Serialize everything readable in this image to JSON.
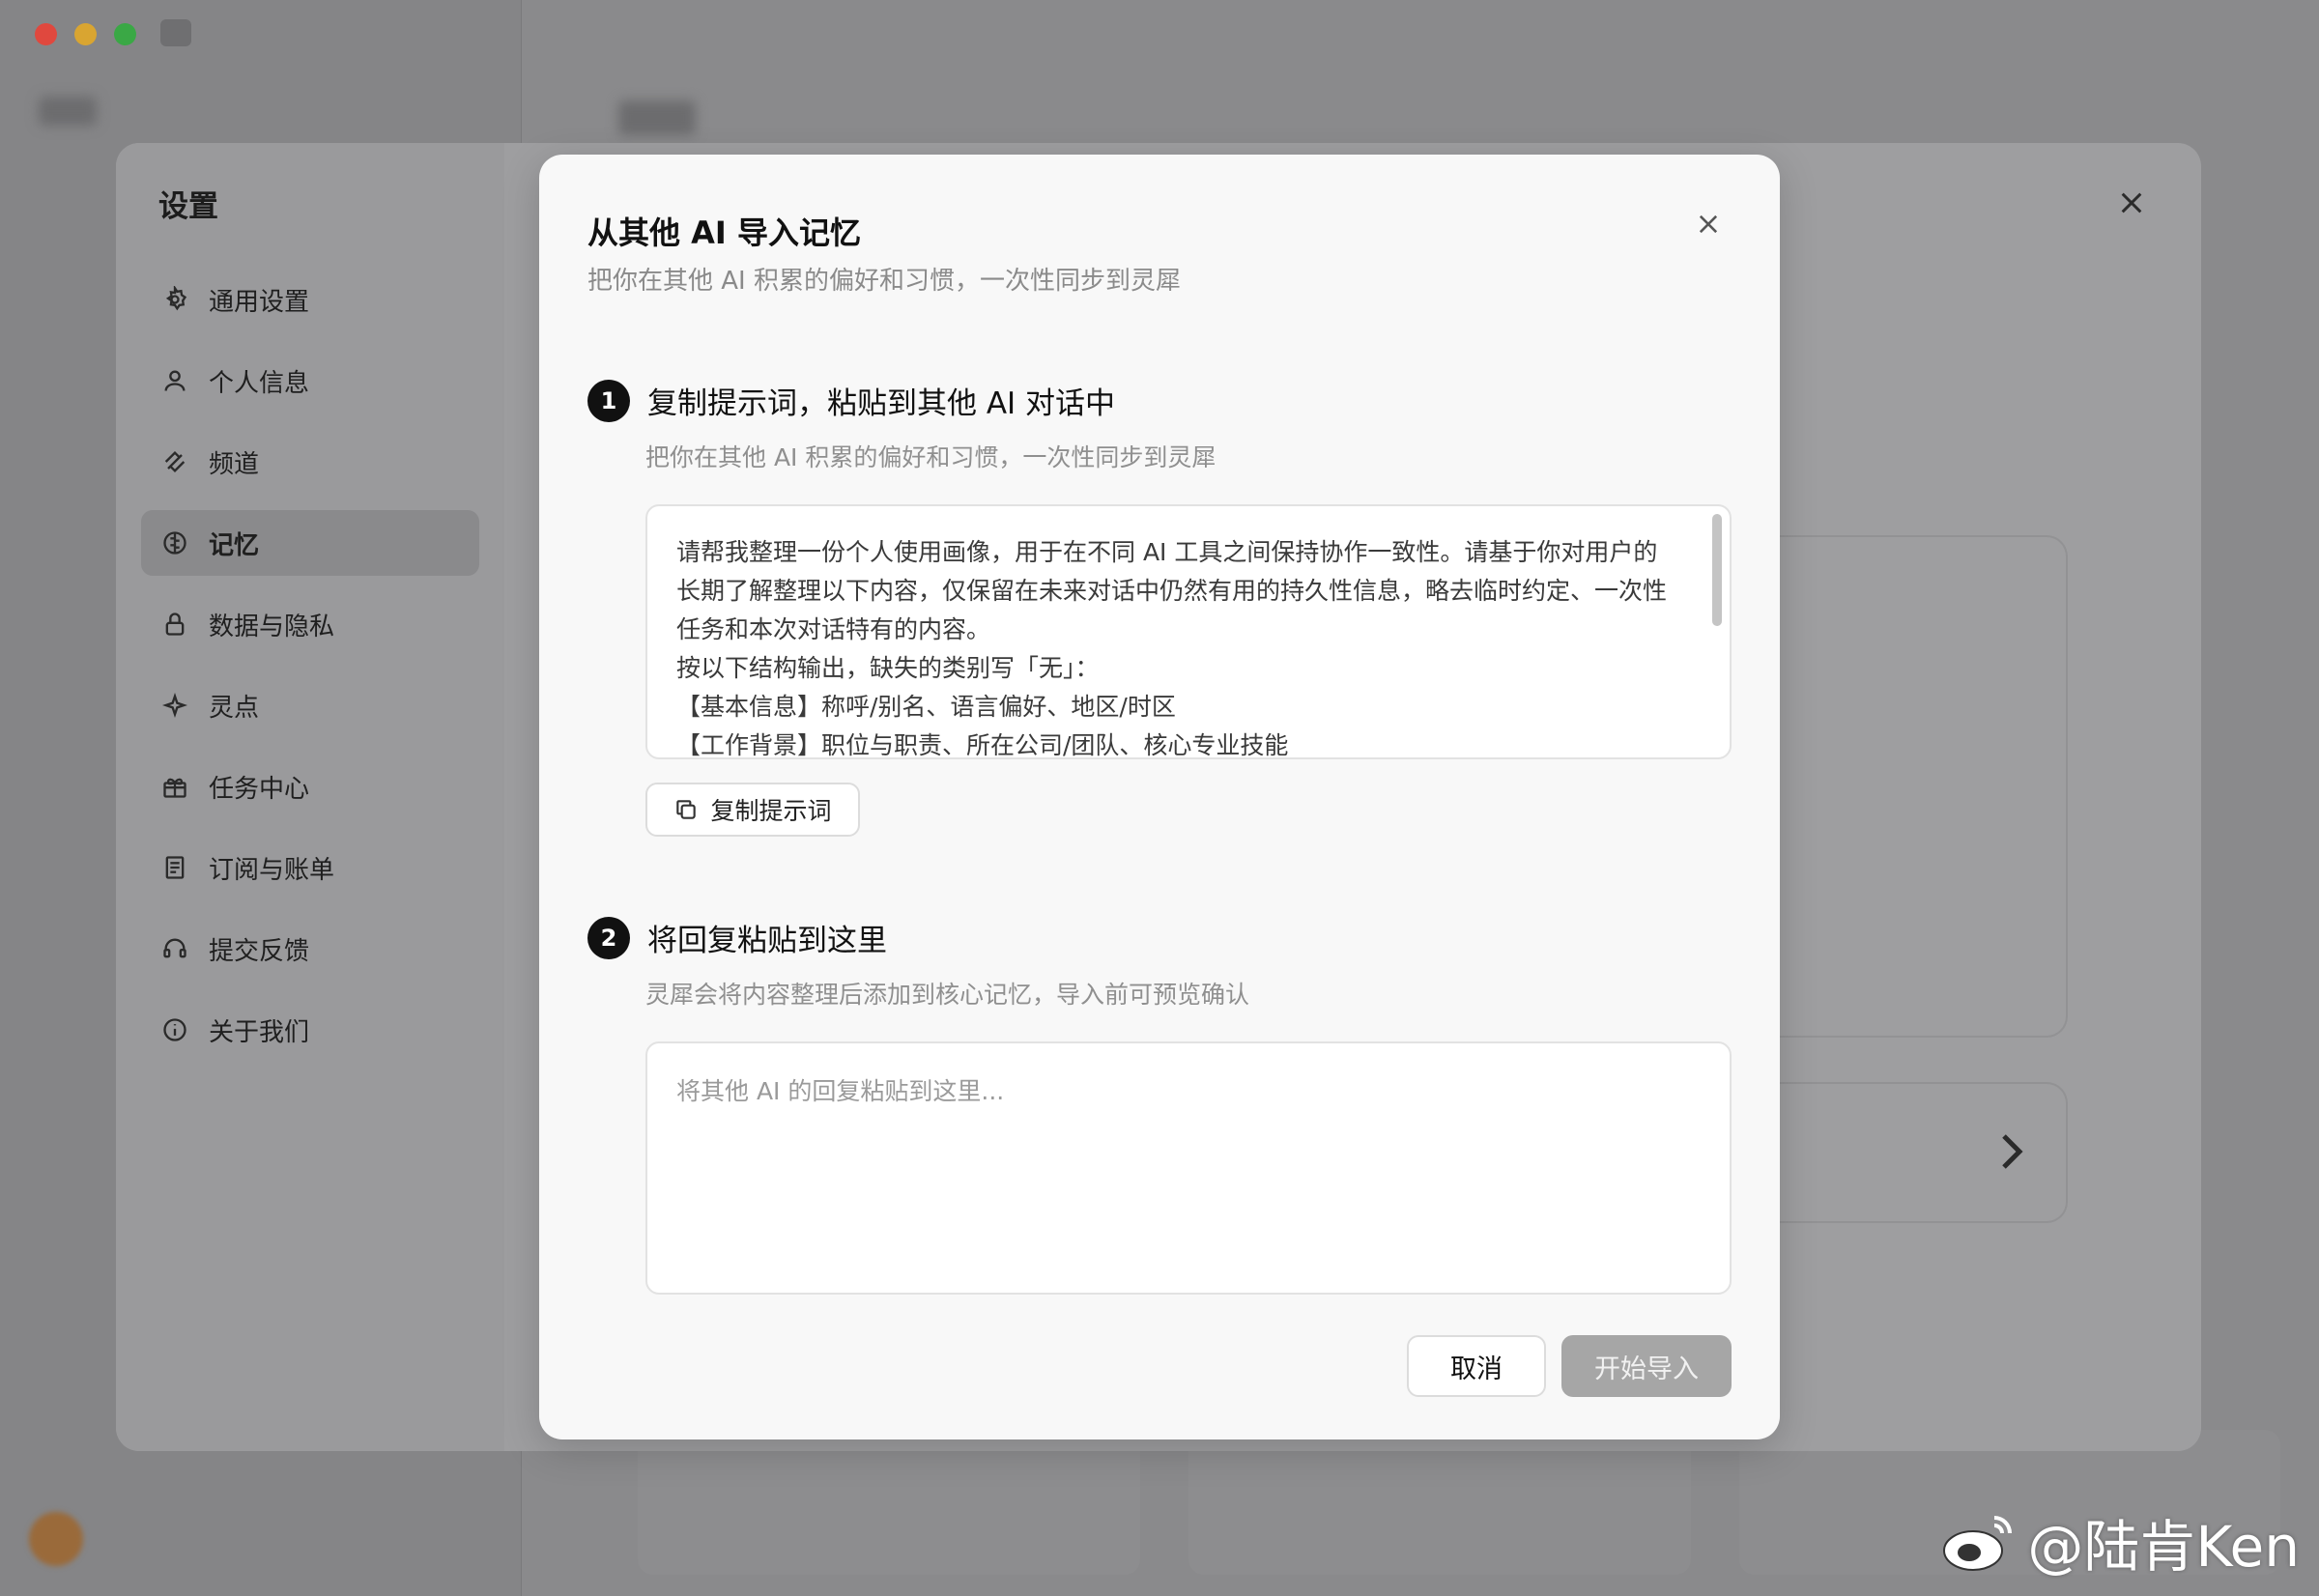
{
  "settings": {
    "title": "设置",
    "nav": [
      {
        "label": "通用设置",
        "icon": "gear-icon"
      },
      {
        "label": "个人信息",
        "icon": "user-icon"
      },
      {
        "label": "频道",
        "icon": "channel-icon"
      },
      {
        "label": "记忆",
        "icon": "brain-icon",
        "active": true
      },
      {
        "label": "数据与隐私",
        "icon": "lock-icon"
      },
      {
        "label": "灵点",
        "icon": "sparkle-icon"
      },
      {
        "label": "任务中心",
        "icon": "gift-icon"
      },
      {
        "label": "订阅与账单",
        "icon": "receipt-icon"
      },
      {
        "label": "提交反馈",
        "icon": "headset-icon"
      },
      {
        "label": "关于我们",
        "icon": "info-icon"
      }
    ]
  },
  "modal": {
    "title": "从其他 AI 导入记忆",
    "subtitle": "把你在其他 AI 积累的偏好和习惯，一次性同步到灵犀",
    "step1": {
      "number": "1",
      "title": "复制提示词，粘贴到其他 AI 对话中",
      "desc": "把你在其他 AI 积累的偏好和习惯，一次性同步到灵犀",
      "prompt_text": "请帮我整理一份个人使用画像，用于在不同 AI 工具之间保持协作一致性。请基于你对用户的长期了解整理以下内容，仅保留在未来对话中仍然有用的持久性信息，略去临时约定、一次性任务和本次对话特有的内容。\n按以下结构输出，缺失的类别写「无」：\n【基本信息】称呼/别名、语言偏好、地区/时区\n【工作背景】职位与职责、所在公司/团队、核心专业技能",
      "copy_button": "复制提示词"
    },
    "step2": {
      "number": "2",
      "title": "将回复粘贴到这里",
      "desc": "灵犀会将内容整理后添加到核心记忆，导入前可预览确认",
      "placeholder": "将其他 AI 的回复粘贴到这里..."
    },
    "cancel_button": "取消",
    "start_button": "开始导入"
  },
  "watermark": "@陆肯Ken"
}
